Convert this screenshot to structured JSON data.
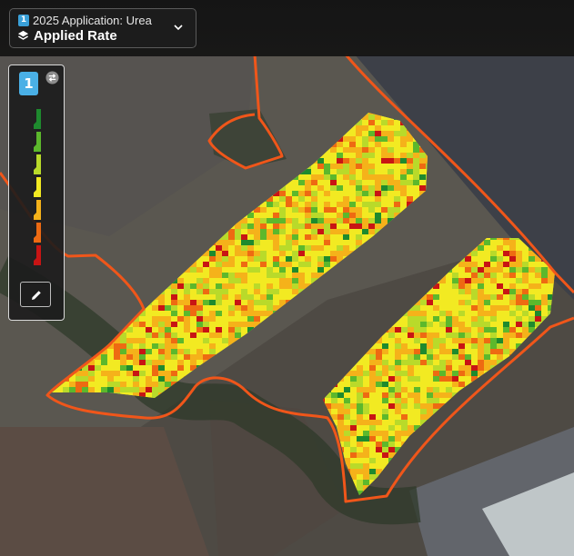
{
  "header": {
    "layer_number": "1",
    "application_name": "2025 Application: Urea",
    "layer_title": "Applied Rate",
    "icons": {
      "layers": "layers-icon",
      "dropdown": "chevron-down-icon"
    }
  },
  "legend": {
    "layer_number": "1",
    "swatches": [
      "#1e8a2e",
      "#5cb82c",
      "#b9da2a",
      "#f2ea22",
      "#f5b21a",
      "#ee6a12",
      "#c81414"
    ],
    "icons": {
      "toggle": "swap-icon",
      "edit": "pencil-icon"
    }
  },
  "map": {
    "boundary_color": "#f0561a",
    "rate_colors": [
      "#1e8a2e",
      "#5cb82c",
      "#b9da2a",
      "#f2ea22",
      "#f5b21a",
      "#ee6a12",
      "#c81414"
    ]
  }
}
